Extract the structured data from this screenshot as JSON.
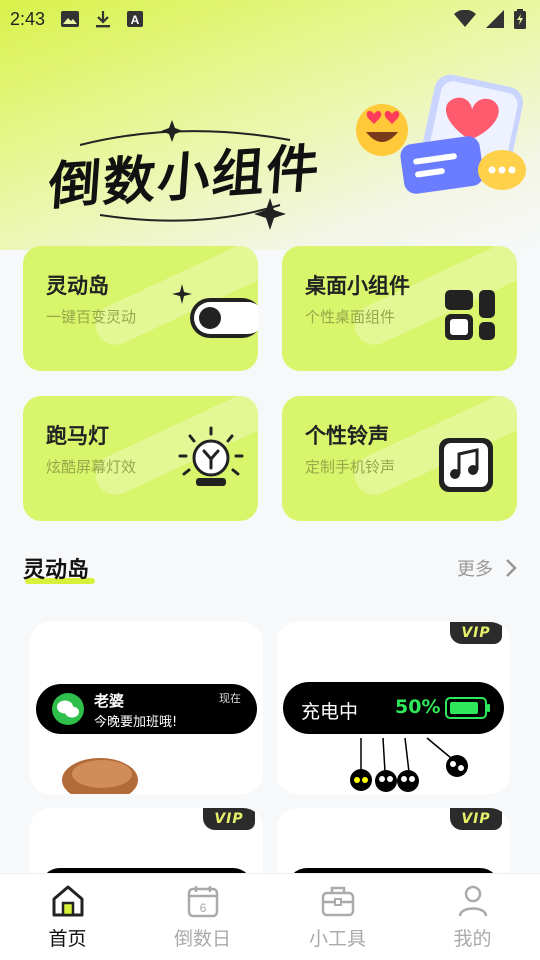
{
  "status_bar": {
    "time": "2:43",
    "left_icons": [
      "image-icon",
      "download-icon",
      "text-a-icon"
    ],
    "right_icons": [
      "wifi-icon",
      "signal-icon",
      "battery-charging-icon"
    ]
  },
  "banner": {
    "title": "倒数小组件",
    "art": "emoji-heart-card-illustration"
  },
  "feature_cards": [
    {
      "title": "灵动岛",
      "subtitle": "一键百变灵动",
      "icon": "toggle-switch-icon"
    },
    {
      "title": "桌面小组件",
      "subtitle": "个性桌面组件",
      "icon": "widget-grid-icon"
    },
    {
      "title": "跑马灯",
      "subtitle": "炫酷屏幕灯效",
      "icon": "lamp-icon"
    },
    {
      "title": "个性铃声",
      "subtitle": "定制手机铃声",
      "icon": "music-note-icon"
    }
  ],
  "section": {
    "title": "灵动岛",
    "more_label": "更多"
  },
  "previews": [
    {
      "vip": false,
      "contact": "老婆",
      "message": "今晚要加班哦!",
      "time": "现在"
    },
    {
      "vip": true,
      "vip_label": "VIP",
      "charging_label": "充电中",
      "battery_percent": "50%"
    },
    {
      "vip": true,
      "vip_label": "VIP"
    },
    {
      "vip": true,
      "vip_label": "VIP"
    }
  ],
  "tabbar": {
    "items": [
      {
        "label": "首页",
        "icon": "home-icon",
        "active": true
      },
      {
        "label": "倒数日",
        "icon": "calendar-icon",
        "active": false
      },
      {
        "label": "小工具",
        "icon": "toolbox-icon",
        "active": false
      },
      {
        "label": "我的",
        "icon": "person-icon",
        "active": false
      }
    ]
  },
  "colors": {
    "accent": "#d8f56b",
    "battery_green": "#2ee85a",
    "vip_text": "#e6f06a"
  }
}
